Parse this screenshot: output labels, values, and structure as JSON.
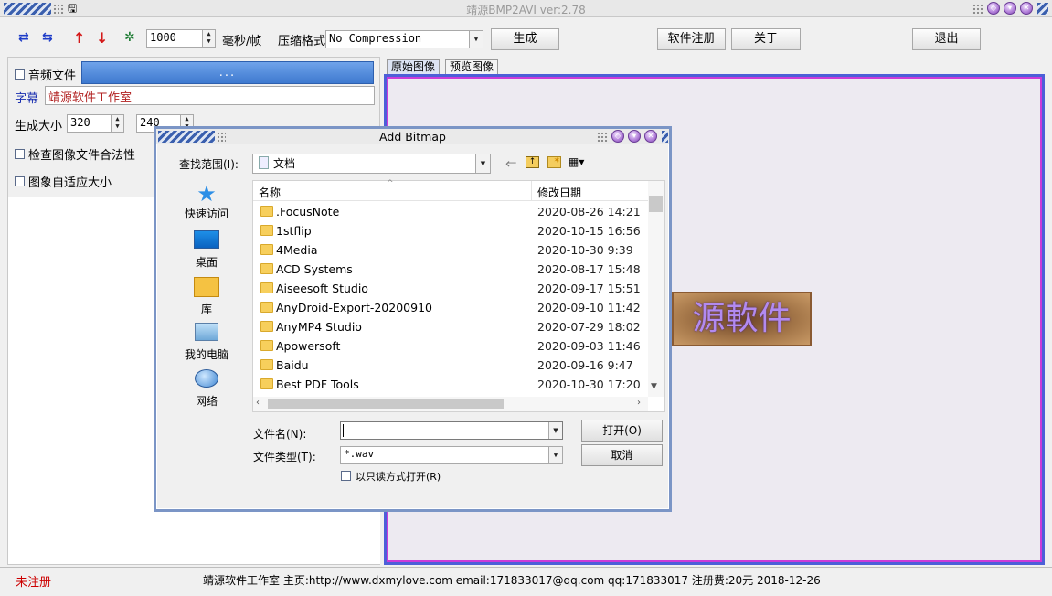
{
  "window": {
    "title": "靖源BMP2AVI ver:2.78"
  },
  "toolbar": {
    "frame_interval": "1000",
    "frame_unit": "毫秒/帧",
    "compress_label": "压缩格式",
    "compress_value": "No Compression",
    "generate": "生成",
    "register": "软件注册",
    "about": "关于",
    "exit": "退出"
  },
  "left": {
    "audio_label": "音频文件",
    "audio_button": "...",
    "subtitle_label": "字幕",
    "subtitle_value": "靖源软件工作室",
    "size_label": "生成大小",
    "width": "320",
    "height": "240",
    "check_image": "检查图像文件合法性",
    "auto_fit": "图象自适应大小"
  },
  "tabs": [
    "原始图像",
    "预览图像"
  ],
  "watermark": "源軟件",
  "dialog": {
    "title": "Add Bitmap",
    "lookin_label": "查找范围(I):",
    "lookin_value": "文档",
    "nav": [
      "快速访问",
      "桌面",
      "库",
      "我的电脑",
      "网络"
    ],
    "columns": {
      "name": "名称",
      "date": "修改日期"
    },
    "files": [
      {
        "name": ".FocusNote",
        "date": "2020-08-26 14:21"
      },
      {
        "name": "1stflip",
        "date": "2020-10-15 16:56"
      },
      {
        "name": "4Media",
        "date": "2020-10-30 9:39"
      },
      {
        "name": "ACD Systems",
        "date": "2020-08-17 15:48"
      },
      {
        "name": "Aiseesoft Studio",
        "date": "2020-09-17 15:51"
      },
      {
        "name": "AnyDroid-Export-20200910",
        "date": "2020-09-10 11:42"
      },
      {
        "name": "AnyMP4 Studio",
        "date": "2020-07-29 18:02"
      },
      {
        "name": "Apowersoft",
        "date": "2020-09-03 11:46"
      },
      {
        "name": "Baidu",
        "date": "2020-09-16 9:47"
      },
      {
        "name": "Best PDF Tools",
        "date": "2020-10-30 17:20"
      }
    ],
    "filename_label": "文件名(N):",
    "filename_value": "",
    "filetype_label": "文件类型(T):",
    "filetype_value": "*.wav",
    "readonly_label": "以只读方式打开(R)",
    "open": "打开(O)",
    "cancel": "取消"
  },
  "status": {
    "unregistered": "未注册",
    "info": "靖源软件工作室  主页:http://www.dxmylove.com email:171833017@qq.com qq:171833017  注册费:20元 2018-12-26"
  },
  "colors": {
    "accent_frame": "#4d5fd8",
    "accent_outline": "#cc3bd8",
    "subtitle_text": "#b22222",
    "unregistered_text": "#cc0000",
    "audio_button": "#4b86d8"
  }
}
